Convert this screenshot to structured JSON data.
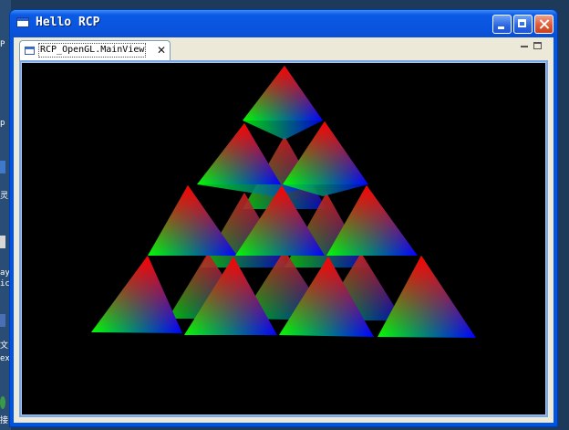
{
  "window": {
    "title": "Hello RCP",
    "buttons": {
      "minimize": "minimize",
      "maximize": "maximize",
      "close": "close"
    }
  },
  "view": {
    "tab_label": "RCP_OpenGL.MainView",
    "tab_close": "✕"
  },
  "desktop_fragments": [
    "P",
    "p",
    "灵",
    "ay",
    "ic",
    "文",
    "ex",
    "接"
  ],
  "scene": {
    "background": "#000000",
    "vertex_colors": {
      "apex": "#ff0000",
      "left": "#00ff00",
      "right": "#0000ff"
    }
  },
  "colors": {
    "titlebar": "#0a55df",
    "frame": "#0054e3",
    "client": "#ece9d8",
    "close_button": "#e05a37"
  }
}
